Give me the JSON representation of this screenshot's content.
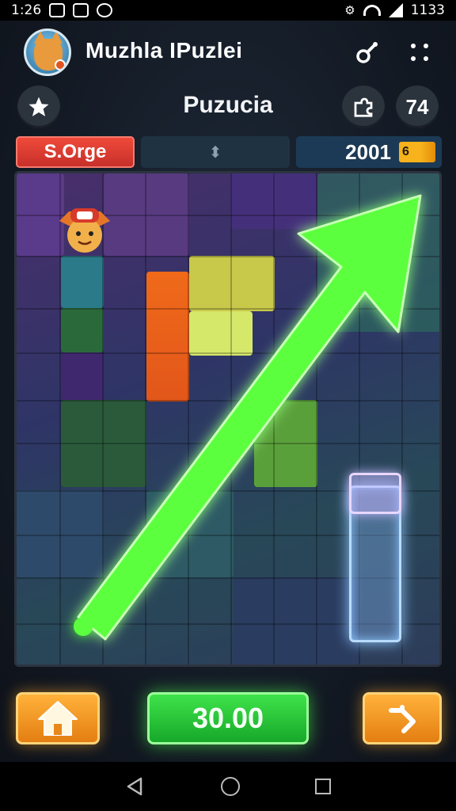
{
  "status_bar": {
    "time": "1:26",
    "clock_right": "1133"
  },
  "header": {
    "app_title": "Muzhla IPuzlei",
    "avatar_icon": "fox-avatar-icon",
    "settings_icon": "wrench-icon",
    "more_icon": "more-dots-icon"
  },
  "toolbar": {
    "mode_title": "Puzucia",
    "star_icon": "star-icon",
    "puzzle_icon": "puzzle-piece-icon",
    "count_label": "74"
  },
  "info_bar": {
    "left_label": "S.Orge",
    "middle_icon_label": "⬍",
    "score_value": "2001",
    "score_badge": "6"
  },
  "bottom_bar": {
    "home_icon": "home-icon",
    "score_button_label": "30.00",
    "next_icon": "next-arrow-icon"
  },
  "colors": {
    "accent_green": "#3fe34a",
    "accent_orange": "#f2961c",
    "accent_red": "#e03a2e",
    "glow_blue": "#8fc7ff"
  }
}
